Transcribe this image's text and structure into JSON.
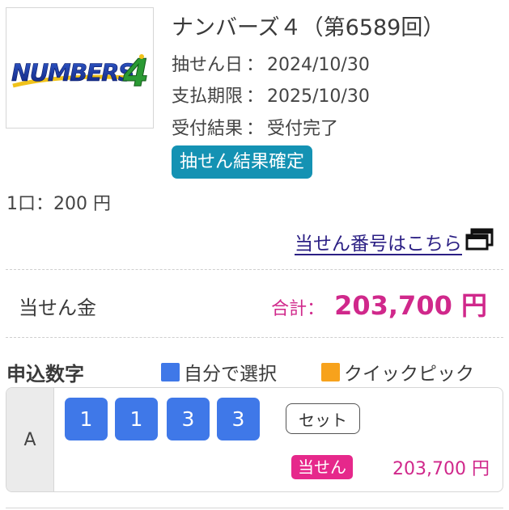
{
  "logo": {
    "text": "NUMBERS",
    "digit": "4",
    "icon": "numbers4-logo"
  },
  "lottery": {
    "title": "ナンバーズ４（第6589回）",
    "draw_date_label": "抽せん日",
    "draw_date": "2024/10/30",
    "payment_deadline_label": "支払期限",
    "payment_deadline": "2025/10/30",
    "reception_result_label": "受付結果",
    "reception_result": "受付完了",
    "separator": "：",
    "status_badge": "抽せん結果確定"
  },
  "unit_price": "1口：200 円",
  "winning_numbers_link": {
    "label": "当せん番号はこちら",
    "icon": "external-window-icon"
  },
  "prize": {
    "label": "当せん金",
    "total_label": "合計：",
    "total_amount": "203,700 円"
  },
  "application": {
    "title": "申込数字",
    "legend_self_select": "自分で選択",
    "legend_quick_pick": "クイックピック"
  },
  "entries": [
    {
      "row_label": "A",
      "digits": [
        "1",
        "1",
        "3",
        "3"
      ],
      "type_badge": "セット",
      "win_badge": "当せん",
      "win_amount": "203,700 円"
    }
  ],
  "colors": {
    "self_select": "#3f78e8",
    "quick_pick": "#f7a21c",
    "status_badge": "#1492b3",
    "prize_accent": "#d0288b",
    "win_badge": "#e6288b",
    "link": "#2b1f84"
  }
}
